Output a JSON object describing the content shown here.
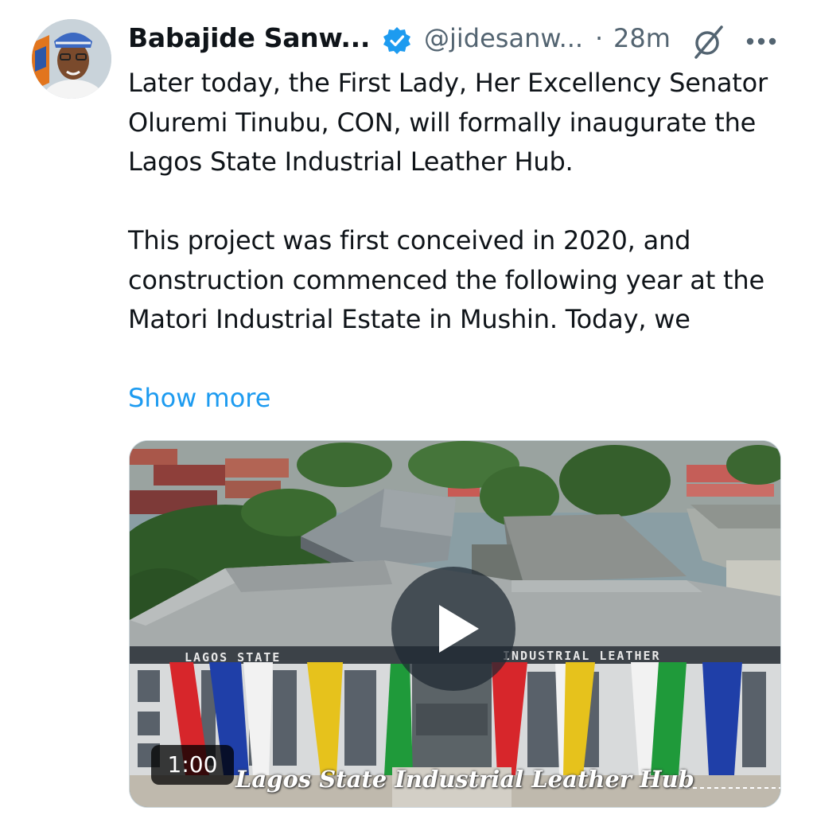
{
  "tweet": {
    "author_name": "Babajide Sanw...",
    "handle": "@jidesanw...",
    "separator": "·",
    "time": "28m",
    "paragraphs": [
      "Later today, the First Lady, Her Excellency Senator Oluremi Tinubu, CON, will formally inaugurate the Lagos State Industrial Leather Hub.",
      "This project was first conceived in 2020, and construction commenced the following year at the Matori Industrial Estate in Mushin. Today, we"
    ],
    "show_more": "Show more"
  },
  "media": {
    "duration": "1:00",
    "caption": "Lagos State Industrial Leather Hub",
    "sign_left": "LAGOS STATE",
    "sign_right": "INDUSTRIAL  LEATHER"
  },
  "icons": {
    "verified": "verified-badge-icon",
    "grok": "grok-icon",
    "more": "more-options-icon",
    "play": "play-icon"
  },
  "colors": {
    "link": "#1d9bf0",
    "verified": "#1d9bf0",
    "secondary_text": "#536471",
    "flag_red": "#d7262b",
    "flag_blue": "#1f3fa8",
    "flag_yellow": "#e6c21c",
    "flag_green": "#1f9a3a"
  }
}
